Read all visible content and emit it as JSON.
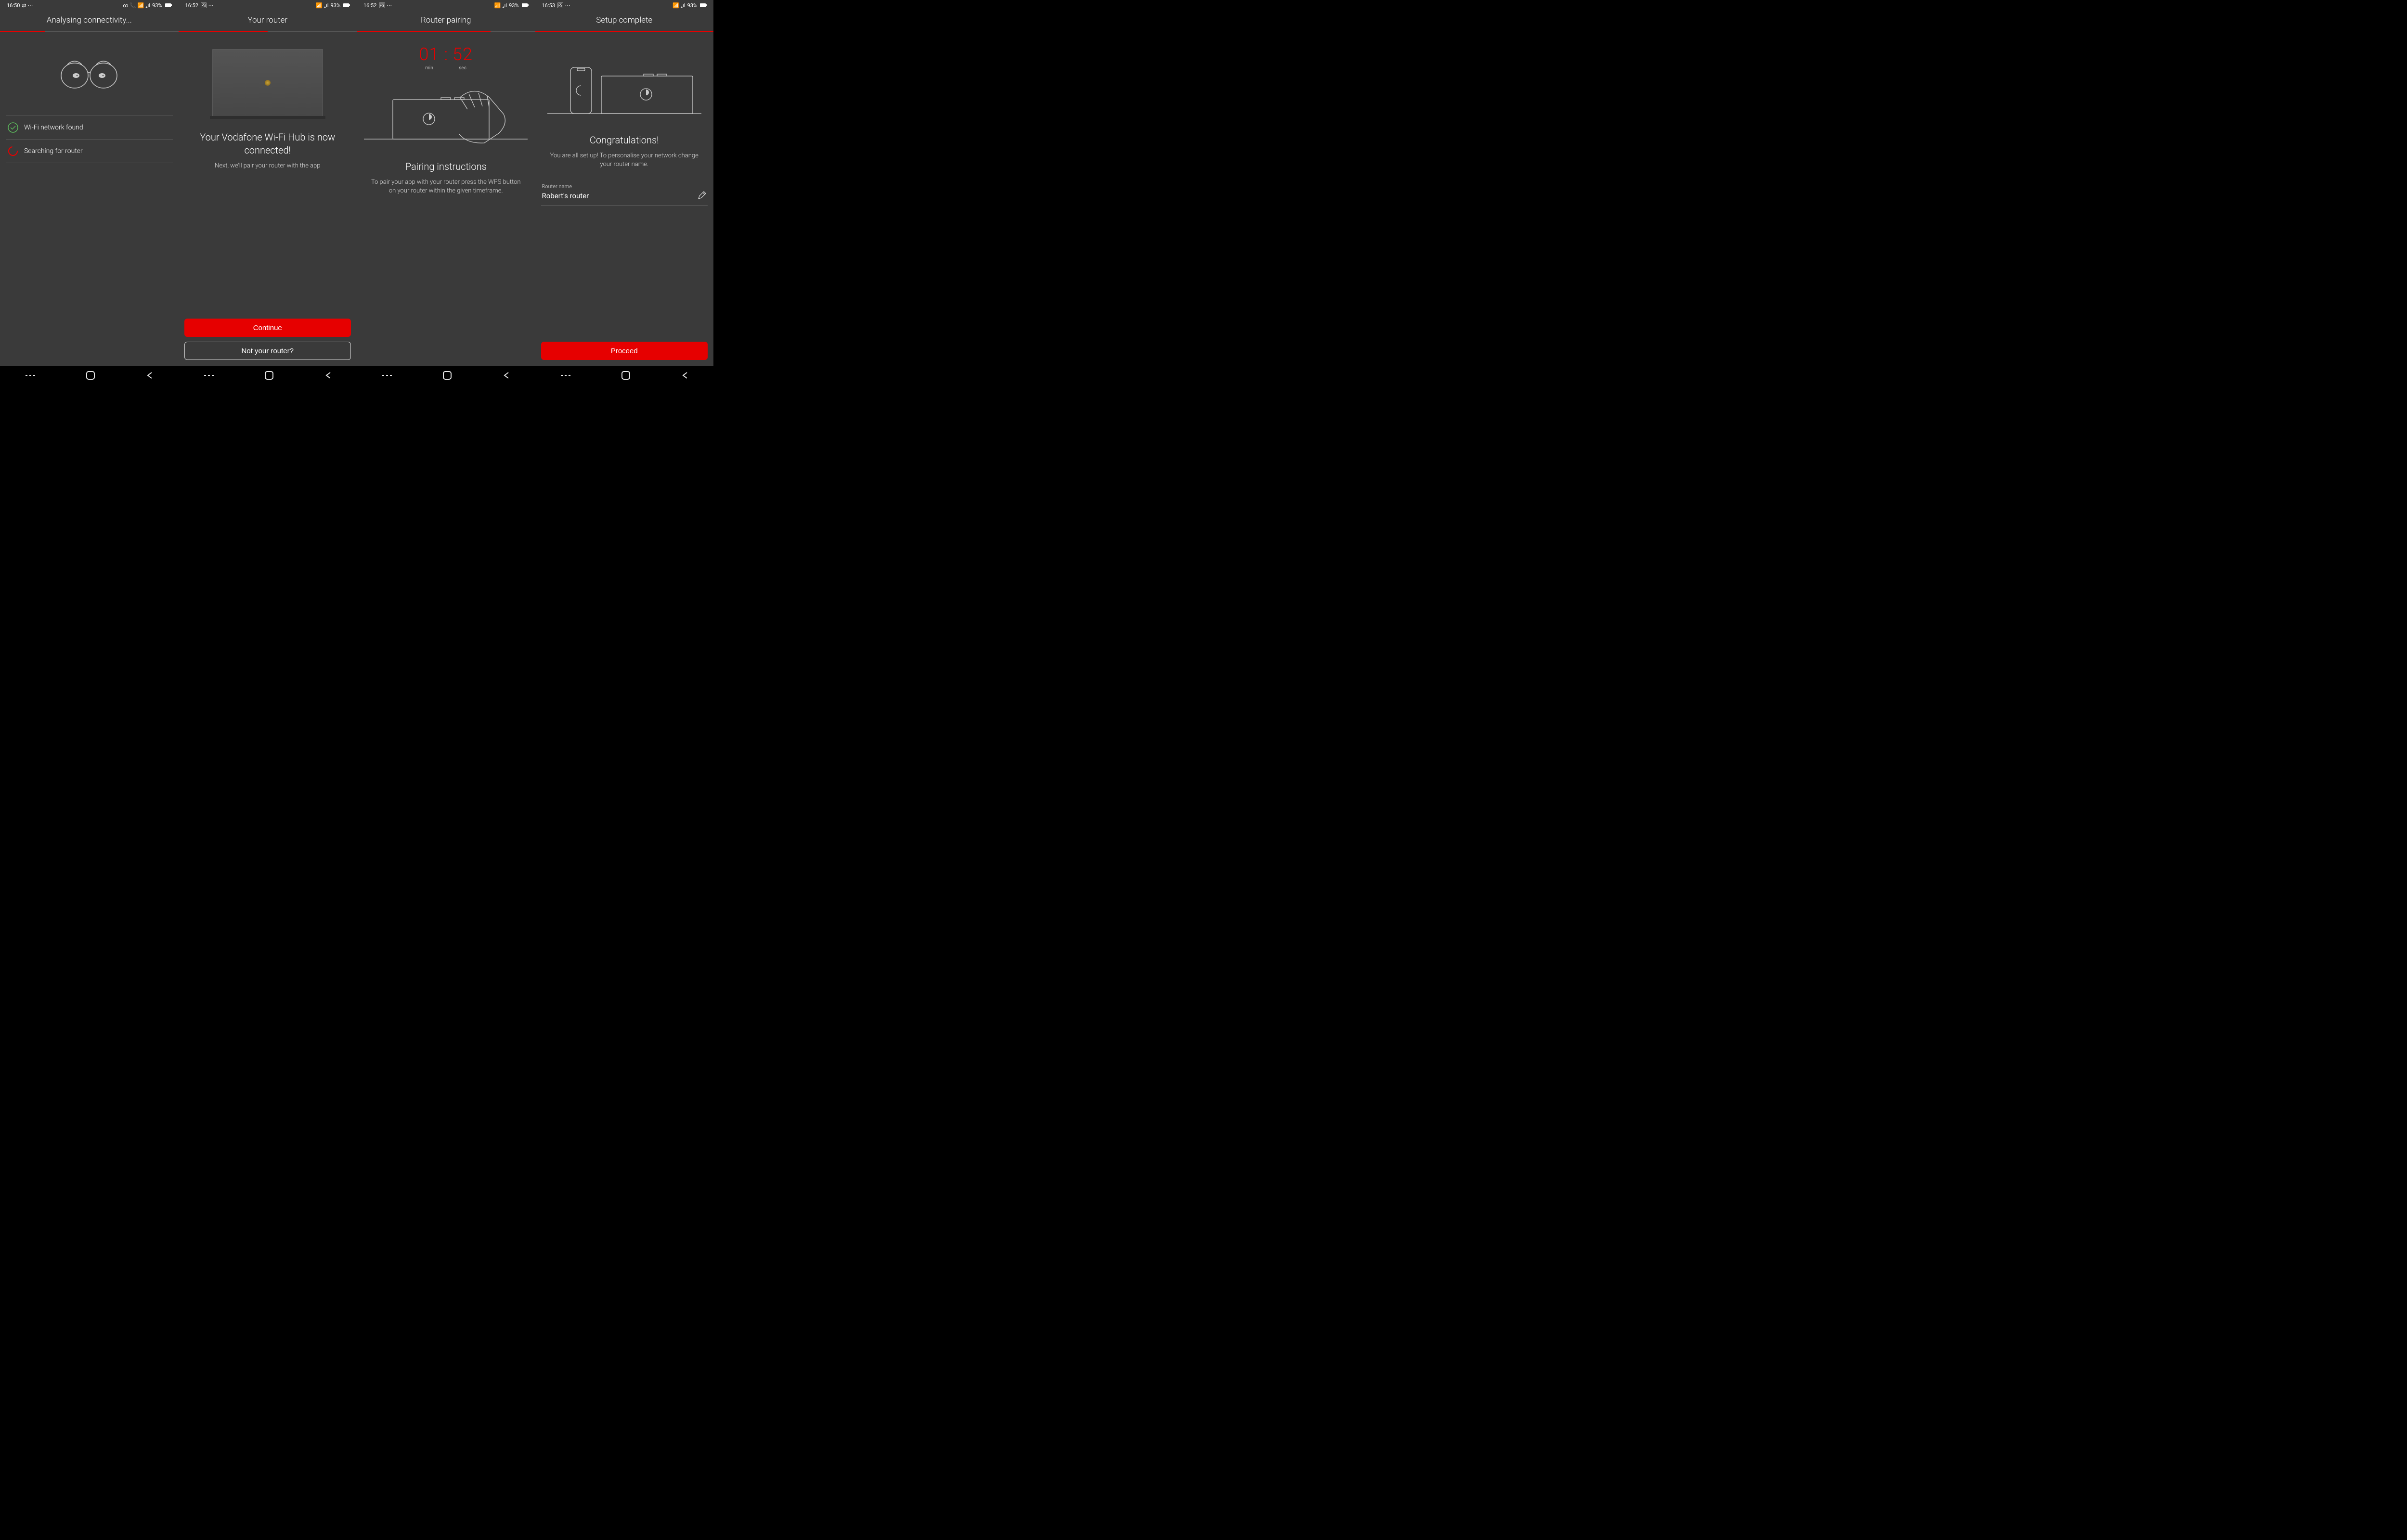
{
  "screens": [
    {
      "status": {
        "time": "16:50",
        "battery": "93%",
        "left_icons": "⇄ ⋯",
        "right_icons": "∞ 📞 📶 ₊ıl"
      },
      "title": "Analysing connectivity...",
      "progress_done": 1,
      "status_items": [
        {
          "icon": "check",
          "text": "Wi-Fi network found"
        },
        {
          "icon": "spin",
          "text": "Searching for router"
        }
      ]
    },
    {
      "status": {
        "time": "16:52",
        "battery": "93%",
        "left_icons": "🖼 ⋯",
        "right_icons": "📶 ₊ıl"
      },
      "title": "Your router",
      "progress_done": 2,
      "heading": "Your Vodafone Wi-Fi Hub is now connected!",
      "subtext": "Next, we'll pair your router with the app",
      "primary_btn": "Continue",
      "secondary_btn": "Not your router?"
    },
    {
      "status": {
        "time": "16:52",
        "battery": "93%",
        "left_icons": "🖼 ⋯",
        "right_icons": "📶 ₊ıl"
      },
      "title": "Router pairing",
      "progress_done": 3,
      "timer": {
        "min": "01",
        "sec": "52",
        "min_label": "min",
        "sec_label": "sec"
      },
      "heading": "Pairing instructions",
      "subtext": "To pair your app with your router press the WPS button on your router within the given timeframe."
    },
    {
      "status": {
        "time": "16:53",
        "battery": "93%",
        "left_icons": "🖼 ⋯",
        "right_icons": "📶 ₊ıl"
      },
      "title": "Setup complete",
      "progress_done": 4,
      "heading": "Congratulations!",
      "subtext": "You are all set up! To personalise your network change your router name.",
      "field_label": "Router name",
      "field_value": "Robert's router",
      "primary_btn": "Proceed"
    }
  ],
  "colors": {
    "accent": "#e60000",
    "success": "#5cb85c"
  }
}
